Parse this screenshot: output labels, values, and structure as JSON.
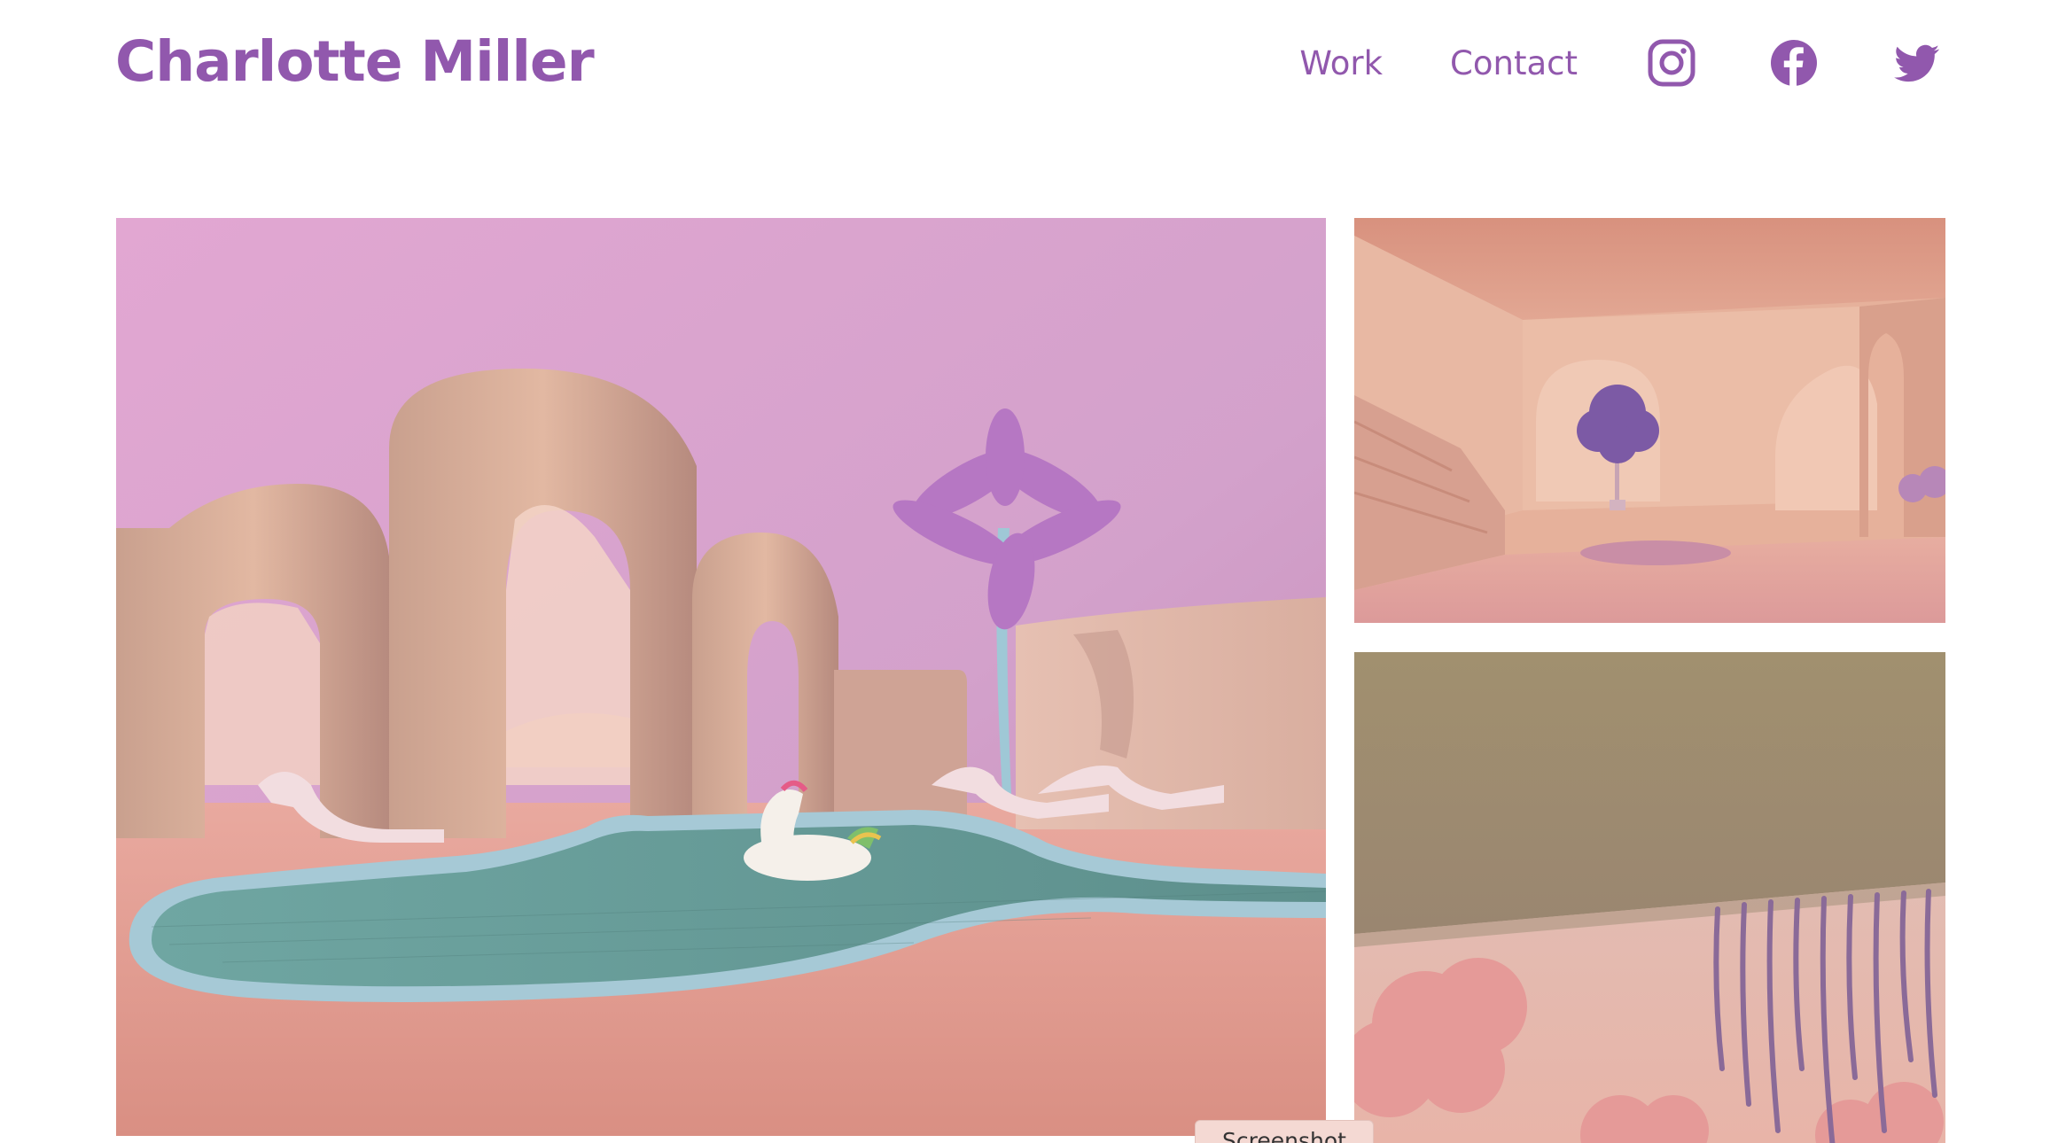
{
  "site": {
    "brand_name": "Charlotte Miller",
    "brand_color": "#9158ad"
  },
  "nav": {
    "links": [
      {
        "label": "Work"
      },
      {
        "label": "Contact"
      }
    ],
    "social_icons": [
      "instagram-icon",
      "facebook-icon",
      "twitter-icon"
    ]
  },
  "gallery": {
    "images": [
      {
        "subject": "pastel pool courtyard with arches, palm tree and unicorn float"
      },
      {
        "subject": "peach interior hall with arches and purple tree"
      },
      {
        "subject": "sunset clouds with hanging purple vines"
      }
    ]
  },
  "overlay": {
    "tab_label": "Screenshot"
  }
}
